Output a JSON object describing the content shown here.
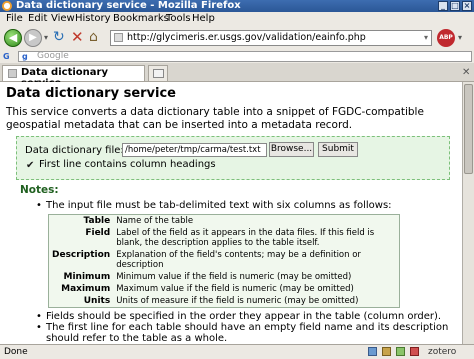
{
  "window": {
    "title": "Data dictionary service - Mozilla Firefox",
    "app_icon": "firefox-icon"
  },
  "menu": [
    "File",
    "Edit",
    "View",
    "History",
    "Bookmarks",
    "Tools",
    "Help"
  ],
  "nav": {
    "url": "http://glycimeris.er.usgs.gov/validation/eainfo.php",
    "search_placeholder": "Google"
  },
  "tabs": [
    {
      "label": "Data dictionary service"
    }
  ],
  "page": {
    "heading": "Data dictionary service",
    "intro": "This service converts a data dictionary table into a snippet of FGDC-compatible geospatial metadata that can be inserted into a metadata record.",
    "form": {
      "file_label": "Data dictionary file:",
      "file_value": "/home/peter/tmp/carma/test.txt",
      "browse_label": "Browse...",
      "submit_label": "Submit",
      "checkbox_label": "First line contains column headings",
      "checkbox_checked": true
    },
    "notes_title": "Notes:",
    "notes": {
      "item1": "The input file must be tab-delimited text with six columns as follows:",
      "table": [
        {
          "key": "Table",
          "desc": "Name of the table"
        },
        {
          "key": "Field",
          "desc": "Label of the field as it appears in the data files. If this field is blank, the description applies to the table itself."
        },
        {
          "key": "Description",
          "desc": "Explanation of the field's contents; may be a definition or description"
        },
        {
          "key": "Minimum",
          "desc": "Minimum value if the field is numeric (may be omitted)"
        },
        {
          "key": "Maximum",
          "desc": "Maximum value if the field is numeric (may be omitted)"
        },
        {
          "key": "Units",
          "desc": "Units of measure if the field is numeric (may be omitted)"
        }
      ],
      "item2": "Fields should be specified in the order they appear in the table (column order).",
      "item3": "The first line for each table should have an empty field name and its description should refer to the table as a whole."
    }
  },
  "status": {
    "text": "Done",
    "zotero": "zotero"
  },
  "colors": {
    "titlebar": "#2b5797",
    "panel_bg": "#e6f5e4",
    "panel_border": "#7cc07a",
    "notes_title": "#206020"
  }
}
